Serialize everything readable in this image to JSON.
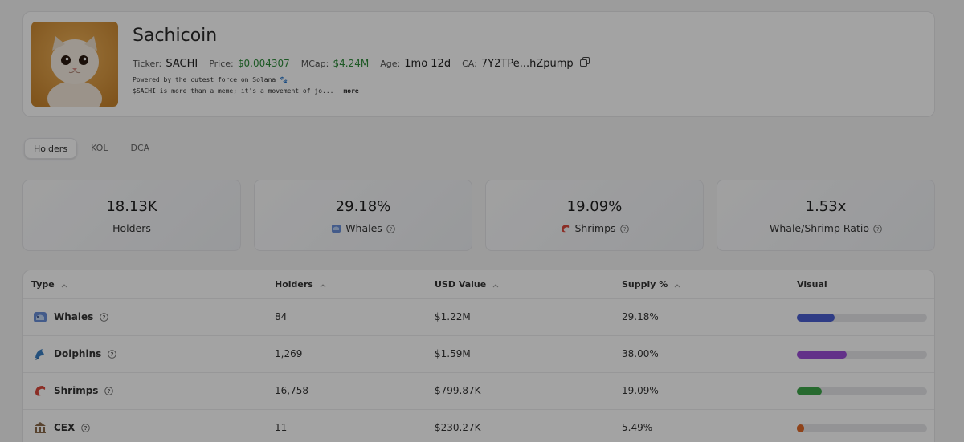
{
  "token": {
    "name": "Sachicoin",
    "ticker_label": "Ticker:",
    "ticker": "SACHI",
    "price_label": "Price:",
    "price": "$0.004307",
    "mcap_label": "MCap:",
    "mcap": "$4.24M",
    "age_label": "Age:",
    "age": "1mo 12d",
    "ca_label": "CA:",
    "ca": "7Y2TPe...hZpump",
    "description_line1": "Powered by the cutest force on Solana 🐾",
    "description_line2": "$SACHI is more than a meme; it's a movement of jo...",
    "more_label": "more"
  },
  "tabs": [
    {
      "label": "Holders",
      "active": true
    },
    {
      "label": "KOL",
      "active": false
    },
    {
      "label": "DCA",
      "active": false
    }
  ],
  "stats": [
    {
      "value": "18.13K",
      "label": "Holders",
      "icon": "none"
    },
    {
      "value": "29.18%",
      "label": "Whales",
      "icon": "whale-icon"
    },
    {
      "value": "19.09%",
      "label": "Shrimps",
      "icon": "shrimp-icon"
    },
    {
      "value": "1.53x",
      "label": "Whale/Shrimp Ratio",
      "icon": "none"
    }
  ],
  "table": {
    "headers": [
      "Type",
      "Holders",
      "USD Value",
      "Supply %",
      "Visual"
    ],
    "rows": [
      {
        "type": "Whales",
        "icon": "whale-icon",
        "holders": "84",
        "usd": "$1.22M",
        "supply": "29.18%",
        "fill": 0.2918,
        "color": "#4a5fd0"
      },
      {
        "type": "Dolphins",
        "icon": "dolphin-icon",
        "holders": "1,269",
        "usd": "$1.59M",
        "supply": "38.00%",
        "fill": 0.38,
        "color": "#9b4dd6"
      },
      {
        "type": "Shrimps",
        "icon": "shrimp-icon",
        "holders": "16,758",
        "usd": "$799.87K",
        "supply": "19.09%",
        "fill": 0.1909,
        "color": "#3da64a"
      },
      {
        "type": "CEX",
        "icon": "bank-icon",
        "holders": "11",
        "usd": "$230.27K",
        "supply": "5.49%",
        "fill": 0.0549,
        "color": "#e0692a"
      }
    ]
  },
  "colors": {
    "positive": "#2e8b3a"
  }
}
